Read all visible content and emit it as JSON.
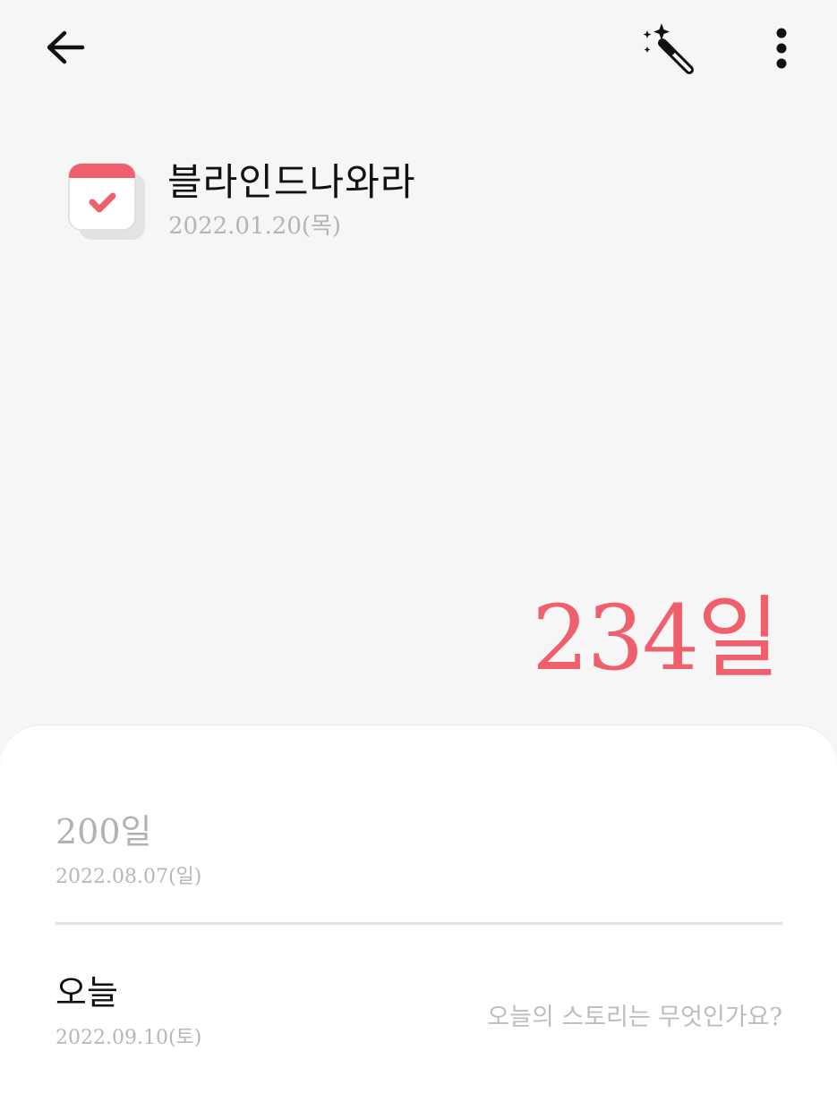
{
  "icons": {
    "back": "arrow-left-icon",
    "magic": "magic-wand-icon",
    "more": "more-vertical-icon",
    "calendar": "calendar-check-icon"
  },
  "colors": {
    "accent": "#f0606c",
    "background": "#f6f6f6",
    "sheet": "#ffffff",
    "muted_text": "#b5b5b5"
  },
  "event": {
    "title": "블라인드나와라",
    "start_date": "2022.01.20(목)",
    "dday": "234일"
  },
  "milestones": [
    {
      "label": "200일",
      "date": "2022.08.07(일)"
    },
    {
      "label": "오늘",
      "date": "2022.09.10(토)",
      "prompt": "오늘의 스토리는 무엇인가요?"
    }
  ]
}
